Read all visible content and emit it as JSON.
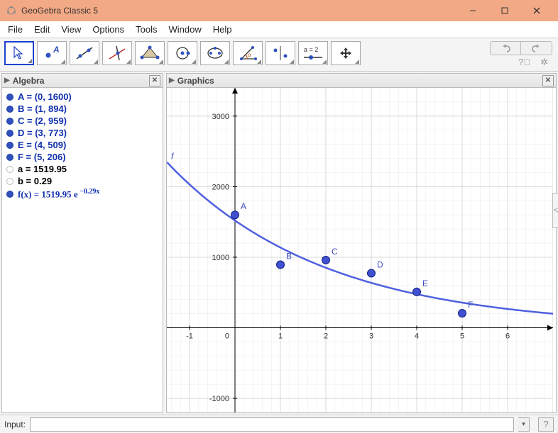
{
  "window": {
    "title": "GeoGebra Classic 5"
  },
  "menu": {
    "items": [
      "File",
      "Edit",
      "View",
      "Options",
      "Tools",
      "Window",
      "Help"
    ]
  },
  "toolbar": {
    "tools": [
      "move-tool",
      "point-tool",
      "line-tool",
      "perpendicular-tool",
      "polygon-tool",
      "circle-tool",
      "ellipse-tool",
      "angle-tool",
      "reflect-tool",
      "slider-tool",
      "move-view-tool"
    ],
    "slider_label": "a = 2"
  },
  "panels": {
    "algebra_title": "Algebra",
    "graphics_title": "Graphics"
  },
  "algebra": {
    "A": "A = (0, 1600)",
    "B": "B = (1, 894)",
    "C": "C = (2, 959)",
    "D": "D = (3, 773)",
    "E": "E = (4, 509)",
    "F": "F = (5, 206)",
    "a": "a = 1519.95",
    "b": "b = 0.29",
    "f_lhs": "f(x)  =  1519.95 e",
    "f_exp": " −0.29x"
  },
  "chart_data": {
    "type": "scatter",
    "title": "",
    "xlabel": "",
    "ylabel": "",
    "xlim": [
      -1.5,
      7
    ],
    "ylim": [
      -1200,
      3400
    ],
    "xticks": [
      -1,
      0,
      1,
      2,
      3,
      4,
      5,
      6
    ],
    "yticks": [
      -1000,
      1000,
      2000,
      3000
    ],
    "points": [
      {
        "name": "A",
        "x": 0,
        "y": 1600
      },
      {
        "name": "B",
        "x": 1,
        "y": 894
      },
      {
        "name": "C",
        "x": 2,
        "y": 959
      },
      {
        "name": "D",
        "x": 3,
        "y": 773
      },
      {
        "name": "E",
        "x": 4,
        "y": 509
      },
      {
        "name": "F",
        "x": 5,
        "y": 206
      }
    ],
    "curve": {
      "name": "f",
      "a": 1519.95,
      "k": 0.29,
      "formula": "f(x)=1519.95*e^(-0.29x)"
    }
  },
  "input": {
    "label": "Input:",
    "value": ""
  }
}
